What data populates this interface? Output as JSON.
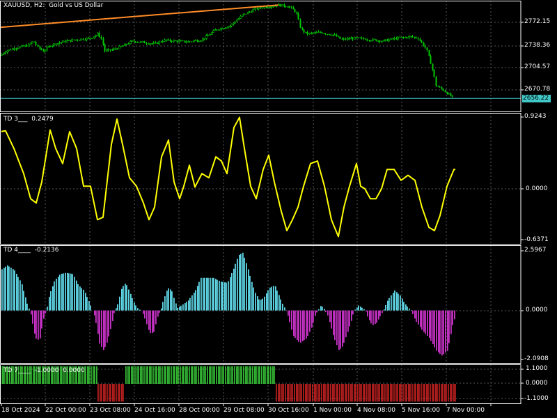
{
  "colors": {
    "background": "#000000",
    "grid": "#5a5a5a",
    "frame": "#ffffff",
    "bull_candle": "#00c800",
    "trend_line": "#ff8c28",
    "bid_line": "#41c8c8",
    "td3_line": "#ffff00",
    "hist_positive": "#5fd6e6",
    "hist_negative": "#c832c8",
    "td7_positive": "#32b432",
    "td7_negative": "#b41e1e"
  },
  "main_panel": {
    "title": "XAUUSD, H2:  Gold vs US Dollar",
    "price_labels": [
      "2772.15",
      "2738.36",
      "2704.57",
      "2670.78"
    ],
    "current_price": "2656.22",
    "price_range": [
      2638,
      2792
    ]
  },
  "td3_panel": {
    "title": "TD 3___  0.2479",
    "scale_labels": [
      "0.9243",
      "0.0000",
      "-0.6371"
    ],
    "range": [
      -0.6371,
      0.9243
    ]
  },
  "td4_panel": {
    "title": "TD 4____  -0.2136",
    "scale_labels": [
      "2.5967",
      "0.0000",
      "-2.0908"
    ],
    "range": [
      -2.0908,
      2.5967
    ]
  },
  "td7_panel": {
    "title": "TD 7____  -1.0000  0.0000",
    "scale_labels": [
      "1.1000",
      "0.0000",
      "-1.1000"
    ],
    "range": [
      -1.1,
      1.1
    ]
  },
  "time_axis": {
    "labels": [
      "18 Oct 2024",
      "22 Oct 00:00",
      "23 Oct 08:00",
      "24 Oct 16:00",
      "28 Oct 00:00",
      "29 Oct 08:00",
      "30 Oct 16:00",
      "1 Nov 00:00",
      "4 Nov 08:00",
      "5 Nov 16:00",
      "7 Nov 00:00"
    ]
  },
  "chart_data": [
    {
      "type": "candlestick",
      "title": "XAUUSD, H2:  Gold vs US Dollar",
      "ylim": [
        2638,
        2792
      ],
      "close_anchors": [
        [
          0,
          2716
        ],
        [
          8,
          2722
        ],
        [
          20,
          2726
        ],
        [
          40,
          2730
        ],
        [
          48,
          2736
        ],
        [
          54,
          2727
        ],
        [
          62,
          2722
        ],
        [
          72,
          2730
        ],
        [
          90,
          2735
        ],
        [
          110,
          2738
        ],
        [
          130,
          2740
        ],
        [
          140,
          2746
        ],
        [
          146,
          2738
        ],
        [
          150,
          2722
        ],
        [
          162,
          2724
        ],
        [
          178,
          2730
        ],
        [
          190,
          2736
        ],
        [
          205,
          2734
        ],
        [
          222,
          2732
        ],
        [
          235,
          2737
        ],
        [
          250,
          2736
        ],
        [
          270,
          2735
        ],
        [
          290,
          2738
        ],
        [
          310,
          2752
        ],
        [
          330,
          2757
        ],
        [
          348,
          2772
        ],
        [
          370,
          2782
        ],
        [
          385,
          2784
        ],
        [
          400,
          2786
        ],
        [
          415,
          2784
        ],
        [
          425,
          2776
        ],
        [
          432,
          2752
        ],
        [
          440,
          2746
        ],
        [
          460,
          2748
        ],
        [
          480,
          2744
        ],
        [
          490,
          2738
        ],
        [
          510,
          2740
        ],
        [
          530,
          2738
        ],
        [
          550,
          2736
        ],
        [
          570,
          2740
        ],
        [
          590,
          2742
        ],
        [
          600,
          2740
        ],
        [
          612,
          2725
        ],
        [
          620,
          2700
        ],
        [
          626,
          2674
        ],
        [
          636,
          2668
        ],
        [
          645,
          2661
        ],
        [
          652,
          2656
        ]
      ]
    },
    {
      "type": "line",
      "name": "trend line",
      "points": [
        [
          0,
          2755
        ],
        [
          400,
          2786
        ]
      ]
    },
    {
      "type": "line",
      "title": "TD 3___  0.2479",
      "ylim": [
        -0.6371,
        0.9243
      ],
      "anchors": [
        [
          0,
          0.7
        ],
        [
          8,
          0.71
        ],
        [
          20,
          0.5
        ],
        [
          34,
          0.2
        ],
        [
          44,
          -0.1
        ],
        [
          52,
          -0.15
        ],
        [
          60,
          0.1
        ],
        [
          72,
          0.72
        ],
        [
          80,
          0.5
        ],
        [
          90,
          0.32
        ],
        [
          100,
          0.7
        ],
        [
          110,
          0.5
        ],
        [
          120,
          0.05
        ],
        [
          130,
          0.05
        ],
        [
          140,
          -0.35
        ],
        [
          148,
          -0.32
        ],
        [
          160,
          0.55
        ],
        [
          168,
          0.85
        ],
        [
          176,
          0.55
        ],
        [
          186,
          0.15
        ],
        [
          196,
          0.05
        ],
        [
          206,
          -0.15
        ],
        [
          214,
          -0.35
        ],
        [
          222,
          -0.2
        ],
        [
          232,
          0.4
        ],
        [
          242,
          0.6
        ],
        [
          250,
          0.1
        ],
        [
          258,
          -0.1
        ],
        [
          264,
          0.05
        ],
        [
          272,
          0.3
        ],
        [
          280,
          0.04
        ],
        [
          290,
          0.2
        ],
        [
          300,
          0.15
        ],
        [
          310,
          0.4
        ],
        [
          318,
          0.35
        ],
        [
          326,
          0.2
        ],
        [
          336,
          0.75
        ],
        [
          344,
          0.87
        ],
        [
          352,
          0.45
        ],
        [
          360,
          0.05
        ],
        [
          368,
          -0.1
        ],
        [
          378,
          0.25
        ],
        [
          386,
          0.42
        ],
        [
          394,
          0.1
        ],
        [
          404,
          -0.25
        ],
        [
          412,
          -0.48
        ],
        [
          420,
          -0.35
        ],
        [
          428,
          -0.2
        ],
        [
          436,
          0.05
        ],
        [
          446,
          0.32
        ],
        [
          456,
          0.35
        ],
        [
          466,
          0.05
        ],
        [
          476,
          -0.35
        ],
        [
          486,
          -0.55
        ],
        [
          494,
          -0.2
        ],
        [
          502,
          0.05
        ],
        [
          512,
          0.32
        ],
        [
          518,
          0.05
        ],
        [
          524,
          0.02
        ],
        [
          532,
          -0.1
        ],
        [
          540,
          -0.1
        ],
        [
          548,
          0.02
        ],
        [
          556,
          0.25
        ],
        [
          566,
          0.25
        ],
        [
          576,
          0.12
        ],
        [
          586,
          0.18
        ],
        [
          596,
          0.12
        ],
        [
          606,
          -0.2
        ],
        [
          616,
          -0.44
        ],
        [
          624,
          -0.48
        ],
        [
          632,
          -0.3
        ],
        [
          642,
          0.05
        ],
        [
          652,
          0.25
        ]
      ]
    },
    {
      "type": "bar",
      "title": "TD 4____  -0.2136",
      "ylim": [
        -2.0908,
        2.5967
      ],
      "anchors": [
        [
          0,
          1.6
        ],
        [
          10,
          1.8
        ],
        [
          20,
          1.6
        ],
        [
          30,
          1.1
        ],
        [
          38,
          0.3
        ],
        [
          42,
          0
        ],
        [
          44,
          -0.2
        ],
        [
          50,
          -1.1
        ],
        [
          56,
          -1.2
        ],
        [
          62,
          -0.3
        ],
        [
          66,
          0
        ],
        [
          70,
          0.6
        ],
        [
          78,
          1.2
        ],
        [
          86,
          1.45
        ],
        [
          94,
          1.5
        ],
        [
          104,
          1.45
        ],
        [
          112,
          1.0
        ],
        [
          120,
          0.8
        ],
        [
          128,
          0.3
        ],
        [
          132,
          0
        ],
        [
          136,
          -0.3
        ],
        [
          142,
          -1.3
        ],
        [
          148,
          -1.6
        ],
        [
          154,
          -1.2
        ],
        [
          160,
          -0.5
        ],
        [
          164,
          0
        ],
        [
          168,
          0.2
        ],
        [
          174,
          0.9
        ],
        [
          180,
          1.1
        ],
        [
          186,
          0.7
        ],
        [
          192,
          0.3
        ],
        [
          198,
          0.05
        ],
        [
          202,
          0
        ],
        [
          206,
          -0.2
        ],
        [
          214,
          -0.9
        ],
        [
          220,
          -0.9
        ],
        [
          226,
          -0.2
        ],
        [
          230,
          0
        ],
        [
          234,
          0.4
        ],
        [
          240,
          0.9
        ],
        [
          246,
          0.8
        ],
        [
          250,
          0.4
        ],
        [
          254,
          0.1
        ],
        [
          260,
          0.2
        ],
        [
          270,
          0.4
        ],
        [
          280,
          0.8
        ],
        [
          288,
          1.3
        ],
        [
          296,
          1.3
        ],
        [
          306,
          1.3
        ],
        [
          316,
          1.15
        ],
        [
          326,
          1.1
        ],
        [
          334,
          1.6
        ],
        [
          342,
          2.2
        ],
        [
          348,
          2.3
        ],
        [
          354,
          1.8
        ],
        [
          360,
          1.2
        ],
        [
          366,
          0.7
        ],
        [
          372,
          0.4
        ],
        [
          378,
          0.5
        ],
        [
          386,
          0.9
        ],
        [
          394,
          1.0
        ],
        [
          400,
          0.6
        ],
        [
          406,
          0.2
        ],
        [
          410,
          0
        ],
        [
          414,
          -0.3
        ],
        [
          420,
          -1.0
        ],
        [
          430,
          -1.3
        ],
        [
          440,
          -1.1
        ],
        [
          448,
          -0.6
        ],
        [
          452,
          -0.2
        ],
        [
          456,
          0
        ],
        [
          460,
          0.2
        ],
        [
          464,
          0.1
        ],
        [
          466,
          0
        ],
        [
          470,
          -0.2
        ],
        [
          478,
          -1.0
        ],
        [
          486,
          -1.6
        ],
        [
          492,
          -1.4
        ],
        [
          498,
          -0.9
        ],
        [
          504,
          -0.4
        ],
        [
          508,
          0
        ],
        [
          514,
          0.2
        ],
        [
          520,
          0.1
        ],
        [
          524,
          0
        ],
        [
          528,
          -0.3
        ],
        [
          534,
          -0.6
        ],
        [
          540,
          -0.5
        ],
        [
          546,
          -0.2
        ],
        [
          550,
          0
        ],
        [
          556,
          0.4
        ],
        [
          566,
          0.8
        ],
        [
          574,
          0.6
        ],
        [
          580,
          0.3
        ],
        [
          586,
          0.1
        ],
        [
          590,
          0
        ],
        [
          596,
          -0.4
        ],
        [
          606,
          -0.8
        ],
        [
          616,
          -1.1
        ],
        [
          626,
          -1.6
        ],
        [
          634,
          -1.8
        ],
        [
          642,
          -1.6
        ],
        [
          650,
          -0.5
        ],
        [
          654,
          -0.2
        ]
      ]
    },
    {
      "type": "bar",
      "title": "TD 7____  -1.0000  0.0000",
      "ylim": [
        -1.1,
        1.1
      ],
      "segments": [
        {
          "from": 0,
          "to": 138,
          "value": 1.0
        },
        {
          "from": 140,
          "to": 178,
          "value": -1.0
        },
        {
          "from": 180,
          "to": 394,
          "value": 1.0
        },
        {
          "from": 396,
          "to": 654,
          "value": -1.0
        }
      ]
    }
  ]
}
